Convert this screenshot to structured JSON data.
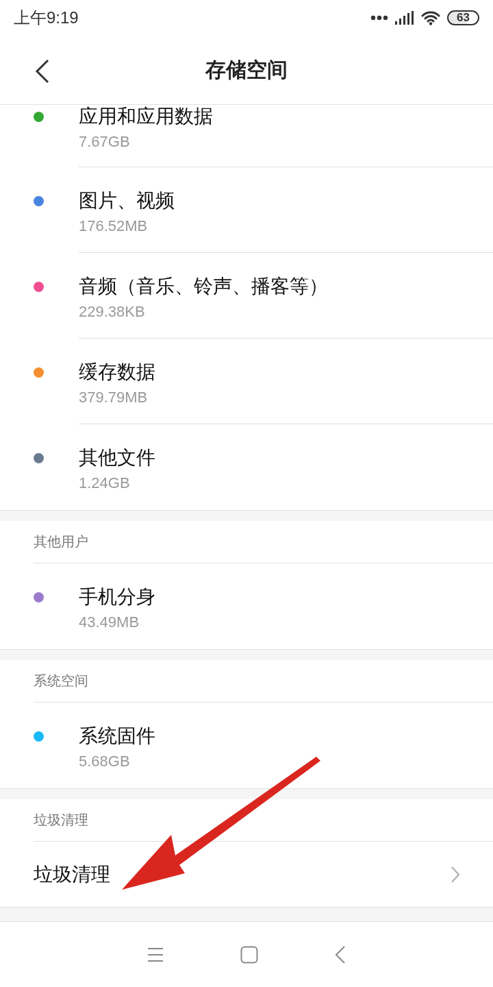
{
  "status_bar": {
    "time": "上午9:19",
    "battery": "63"
  },
  "header": {
    "title": "存储空间"
  },
  "sections": [
    {
      "items": [
        {
          "kind": "storage",
          "name": "应用和应用数据",
          "size": "7.67GB",
          "color": "#33a833"
        },
        {
          "kind": "storage",
          "name": "图片、视频",
          "size": "176.52MB",
          "color": "#4a86e0"
        },
        {
          "kind": "storage",
          "name": "音频（音乐、铃声、播客等）",
          "size": "229.38KB",
          "color": "#ef4f91"
        },
        {
          "kind": "storage",
          "name": "缓存数据",
          "size": "379.79MB",
          "color": "#f5902e"
        },
        {
          "kind": "storage",
          "name": "其他文件",
          "size": "1.24GB",
          "color": "#6b7a8f"
        }
      ]
    },
    {
      "heading": "其他用户",
      "items": [
        {
          "kind": "storage",
          "name": "手机分身",
          "size": "43.49MB",
          "color": "#9b7ccc"
        }
      ]
    },
    {
      "heading": "系统空间",
      "items": [
        {
          "kind": "storage",
          "name": "系统固件",
          "size": "5.68GB",
          "color": "#1ab8f5"
        }
      ]
    },
    {
      "heading": "垃圾清理",
      "items": [
        {
          "kind": "link",
          "name": "垃圾清理"
        }
      ]
    }
  ]
}
